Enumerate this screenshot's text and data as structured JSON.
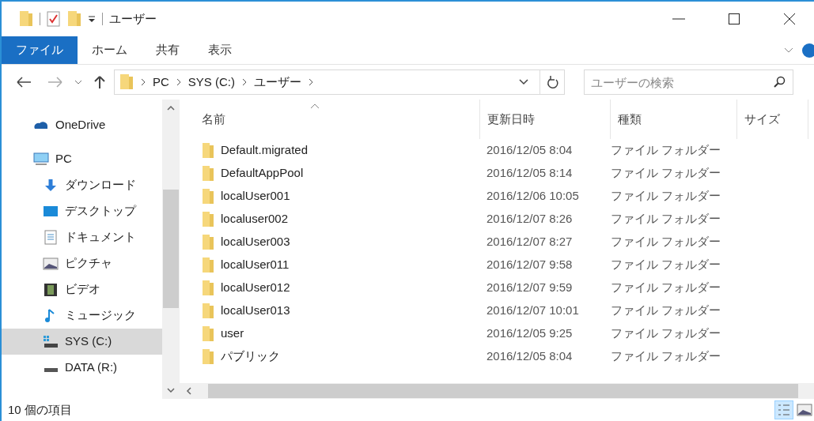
{
  "window": {
    "title": "ユーザー"
  },
  "ribbon_tabs": [
    {
      "label": "ファイル",
      "selected": true
    },
    {
      "label": "ホーム",
      "selected": false
    },
    {
      "label": "共有",
      "selected": false
    },
    {
      "label": "表示",
      "selected": false
    }
  ],
  "breadcrumb": [
    "PC",
    "SYS (C:)",
    "ユーザー"
  ],
  "search": {
    "placeholder": "ユーザーの検索"
  },
  "sidebar": {
    "items": [
      {
        "label": "OneDrive",
        "kind": "cloud",
        "selected": false
      },
      {
        "label": "PC",
        "kind": "pc",
        "selected": false,
        "children": [
          {
            "label": "ダウンロード",
            "kind": "download",
            "selected": false
          },
          {
            "label": "デスクトップ",
            "kind": "desktop",
            "selected": false
          },
          {
            "label": "ドキュメント",
            "kind": "document",
            "selected": false
          },
          {
            "label": "ピクチャ",
            "kind": "picture",
            "selected": false
          },
          {
            "label": "ビデオ",
            "kind": "video",
            "selected": false
          },
          {
            "label": "ミュージック",
            "kind": "music",
            "selected": false
          },
          {
            "label": "SYS (C:)",
            "kind": "sysdrive",
            "selected": true
          },
          {
            "label": "DATA (R:)",
            "kind": "drive",
            "selected": false
          }
        ]
      }
    ]
  },
  "table": {
    "columns": [
      "名前",
      "更新日時",
      "種類",
      "サイズ"
    ],
    "rows": [
      {
        "name": "Default.migrated",
        "modified": "2016/12/05 8:04",
        "type": "ファイル フォルダー"
      },
      {
        "name": "DefaultAppPool",
        "modified": "2016/12/05 8:14",
        "type": "ファイル フォルダー"
      },
      {
        "name": "localUser001",
        "modified": "2016/12/06 10:05",
        "type": "ファイル フォルダー"
      },
      {
        "name": "localuser002",
        "modified": "2016/12/07 8:26",
        "type": "ファイル フォルダー"
      },
      {
        "name": "localUser003",
        "modified": "2016/12/07 8:27",
        "type": "ファイル フォルダー"
      },
      {
        "name": "localUser011",
        "modified": "2016/12/07 9:58",
        "type": "ファイル フォルダー"
      },
      {
        "name": "localUser012",
        "modified": "2016/12/07 9:59",
        "type": "ファイル フォルダー"
      },
      {
        "name": "localUser013",
        "modified": "2016/12/07 10:01",
        "type": "ファイル フォルダー"
      },
      {
        "name": "user",
        "modified": "2016/12/05 9:25",
        "type": "ファイル フォルダー"
      },
      {
        "name": "パブリック",
        "modified": "2016/12/05 8:04",
        "type": "ファイル フォルダー"
      }
    ]
  },
  "status_bar": {
    "text": "10 個の項目"
  }
}
